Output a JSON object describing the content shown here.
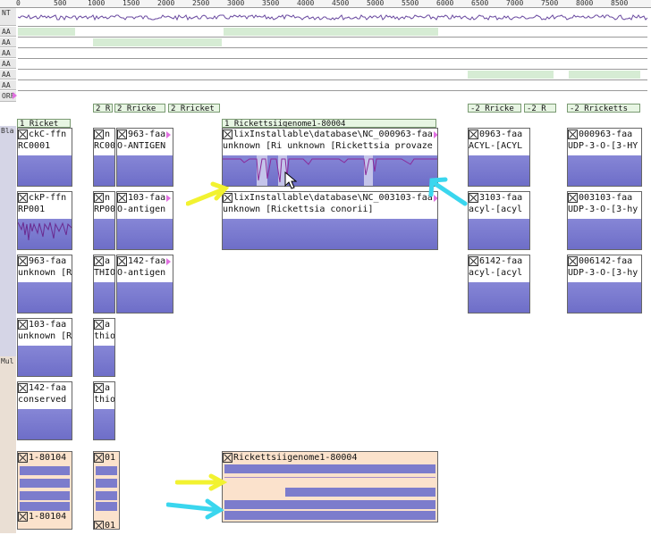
{
  "ruler": {
    "ticks": [
      "0",
      "500",
      "1000",
      "1500",
      "2000",
      "2500",
      "3000",
      "3500",
      "4000",
      "4500",
      "5000",
      "5500",
      "6000",
      "6500",
      "7000",
      "7500",
      "8000",
      "8500"
    ]
  },
  "rows": {
    "nt": "NT",
    "aa": [
      "AA",
      "AA",
      "AA",
      "AA",
      "AA",
      "AA"
    ],
    "orf": "ORF",
    "bla": "Bla",
    "mul": "Mul"
  },
  "orf_boxes": [
    "1 Ricket",
    "2 R",
    "2 Rricke",
    "2 Rricket",
    "1 Rickettsiigenome1-80004",
    "-2 Rricke",
    "-2 R",
    "-2 Rricketts"
  ],
  "panels": {
    "c1": [
      {
        "title": "ckC-ffn",
        "sub": "RC0001"
      },
      {
        "title": "ckP-ffn",
        "sub": "RP001"
      },
      {
        "title": "963-faa",
        "sub": "unknown [R"
      },
      {
        "title": "103-faa",
        "sub": "unknown [R"
      },
      {
        "title": "142-faa",
        "sub": "conserved"
      }
    ],
    "c2": [
      {
        "title": "n",
        "sub": "RC00"
      },
      {
        "title": "n",
        "sub": "RP00"
      },
      {
        "title": "a",
        "sub": "THIO"
      },
      {
        "title": "a",
        "sub": "thio"
      },
      {
        "title": "a",
        "sub": "thio"
      }
    ],
    "c3": [
      {
        "title": "963-faa",
        "sub": "O-ANTIGEN"
      },
      {
        "title": "103-faa",
        "sub": "O-antigen"
      },
      {
        "title": "142-faa",
        "sub": "O-antigen"
      }
    ],
    "big1": {
      "title": "lixInstallable\\database\\NC_000963-faa",
      "sub": "unknown [Ri unknown [Rickettsia provaze"
    },
    "big2": {
      "title": "lixInstallable\\database\\NC_003103-faa",
      "sub": "unknown [Rickettsia conorii]"
    },
    "c5": [
      {
        "title": "0963-faa",
        "sub": "ACYL-[ACYL"
      },
      {
        "title": "3103-faa",
        "sub": "acyl-[acyl"
      },
      {
        "title": "6142-faa",
        "sub": "acyl-[acyl"
      }
    ],
    "c6": [
      {
        "title": "000963-faa",
        "sub": "UDP-3-O-[3-HY"
      },
      {
        "title": "003103-faa",
        "sub": "UDP-3-O-[3-hy"
      },
      {
        "title": "006142-faa",
        "sub": "UDP-3-O-[3-hy"
      }
    ]
  },
  "multi": {
    "left_top": "1-80104",
    "left_bottom": "1-80104",
    "mid_top": "01",
    "mid_bottom": "01",
    "big": "Rickettsiigenome1-80004"
  },
  "colors": {
    "track": "#7a7acc",
    "highlight": "#d6ecd4",
    "multi_bg": "#fbe2cc",
    "yellow_arrow": "#f2f230",
    "cyan_arrow": "#3ad6ee"
  }
}
